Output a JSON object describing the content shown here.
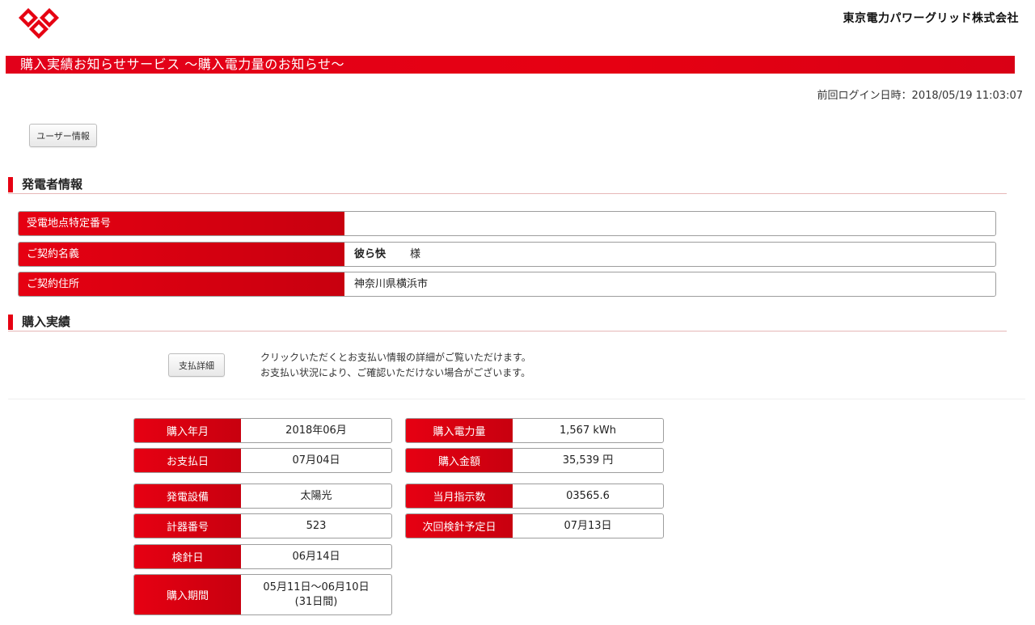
{
  "header": {
    "company_name": "東京電力パワーグリッド株式会社",
    "logo_icon": "tepco-diamond-logo-icon",
    "brand_color": "#e60012"
  },
  "title_bar": {
    "title": "購入実績お知らせサービス ～購入電力量のお知らせ～"
  },
  "last_login": {
    "text": "前回ログイン日時：2018/05/19 11:03:07"
  },
  "buttons": {
    "user_info": "ユーザー情報",
    "payment_detail": "支払詳細"
  },
  "generator_info": {
    "heading": "発電者情報",
    "rows": [
      {
        "label": "受電地点特定番号",
        "value": ""
      },
      {
        "label": "ご契約名義",
        "value": "彼ら快",
        "suffix": "様"
      },
      {
        "label": "ご契約住所",
        "value": "神奈川県横浜市"
      }
    ]
  },
  "purchase_record": {
    "heading": "購入実績",
    "note_line1": "クリックいただくとお支払い情報の詳細がご覧いただけます。",
    "note_line2": "お支払い状況により、ご確認いただけない場合がございます。",
    "fields": {
      "purchase_month": {
        "label": "購入年月",
        "value": "2018年06月"
      },
      "payment_date": {
        "label": "お支払日",
        "value": "07月04日"
      },
      "facility": {
        "label": "発電設備",
        "value": "太陽光"
      },
      "meter_number": {
        "label": "計器番号",
        "value": "523"
      },
      "reading_date": {
        "label": "検針日",
        "value": "06月14日"
      },
      "purchase_period": {
        "label": "購入期間",
        "value_line1": "05月11日～06月10日",
        "value_line2": "(31日間)"
      },
      "purchase_kwh": {
        "label": "購入電力量",
        "value": "1,567 kWh"
      },
      "purchase_amount": {
        "label": "購入金額",
        "value": "35,539 円"
      },
      "meter_reading": {
        "label": "当月指示数",
        "value": "03565.6"
      },
      "next_reading_date": {
        "label": "次回検針予定日",
        "value": "07月13日"
      }
    }
  }
}
